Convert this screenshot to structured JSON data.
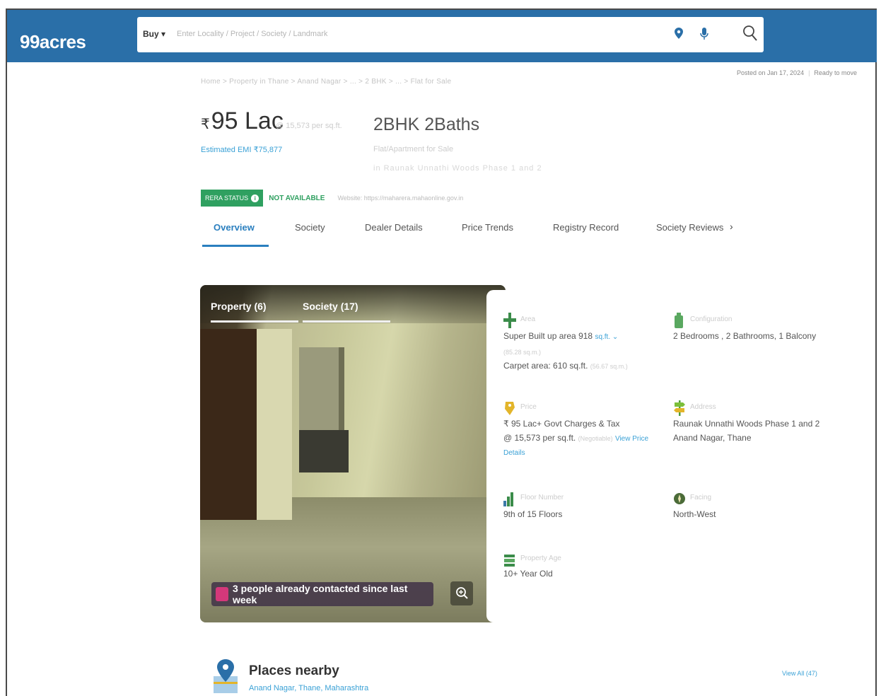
{
  "header": {
    "logo": "99acres",
    "buy_label": "Buy ▾",
    "search_placeholder": "Enter Locality / Project / Society / Landmark"
  },
  "breadcrumb": "Home > Property in Thane > Anand Nagar > ... > 2 BHK > ... > Flat for Sale",
  "posted": {
    "date": "Posted on Jan 17, 2024",
    "status": "Ready to move"
  },
  "summary": {
    "currency": "₹",
    "price": "95 Lac",
    "price_per_sqft": "@ 15,573 per sq.ft.",
    "emi": "Estimated EMI ₹75,877",
    "config": "2BHK 2Baths",
    "subtitle": "Flat/Apartment for Sale",
    "subtitle2": "in Raunak Unnathi Woods Phase 1 and 2"
  },
  "rera": {
    "badge": "RERA STATUS",
    "status": "NOT AVAILABLE",
    "website": "Website: https://maharera.mahaonline.gov.in"
  },
  "tabs": [
    {
      "label": "Overview"
    },
    {
      "label": "Society"
    },
    {
      "label": "Dealer Details"
    },
    {
      "label": "Price Trends"
    },
    {
      "label": "Registry Record"
    },
    {
      "label": "Society Reviews"
    }
  ],
  "gallery": {
    "tab_property": "Property (6)",
    "tab_society": "Society (17)",
    "contacted": "3 people already contacted since last week"
  },
  "details": {
    "area": {
      "label": "Area",
      "super_built_up": "Super Built up area 918",
      "unit": "sq.ft. ⌄",
      "area_sub": "(85.28 sq.m.)",
      "carpet": "Carpet area: 610 sq.ft.",
      "carpet_sub": "(56.67 sq.m.)"
    },
    "configuration": {
      "label": "Configuration",
      "value": "2 Bedrooms , 2 Bathrooms, 1 Balcony"
    },
    "price": {
      "label": "Price",
      "line1": "₹ 95 Lac+ Govt Charges & Tax",
      "line2": "@ 15,573 per sq.ft.",
      "negotiable": "(Negotiable)",
      "view_price": "View Price",
      "details_link": "Details"
    },
    "address": {
      "label": "Address",
      "line1": "Raunak Unnathi Woods Phase 1 and 2",
      "line2": "Anand Nagar, Thane"
    },
    "floor": {
      "label": "Floor Number",
      "value": "9th  of 15 Floors"
    },
    "facing": {
      "label": "Facing",
      "value": "North-West"
    },
    "age": {
      "label": "Property Age",
      "value": "10+ Year Old"
    }
  },
  "places": {
    "title": "Places nearby",
    "subtitle": "Anand Nagar, Thane, Maharashtra",
    "view_all": "View All (47)"
  }
}
